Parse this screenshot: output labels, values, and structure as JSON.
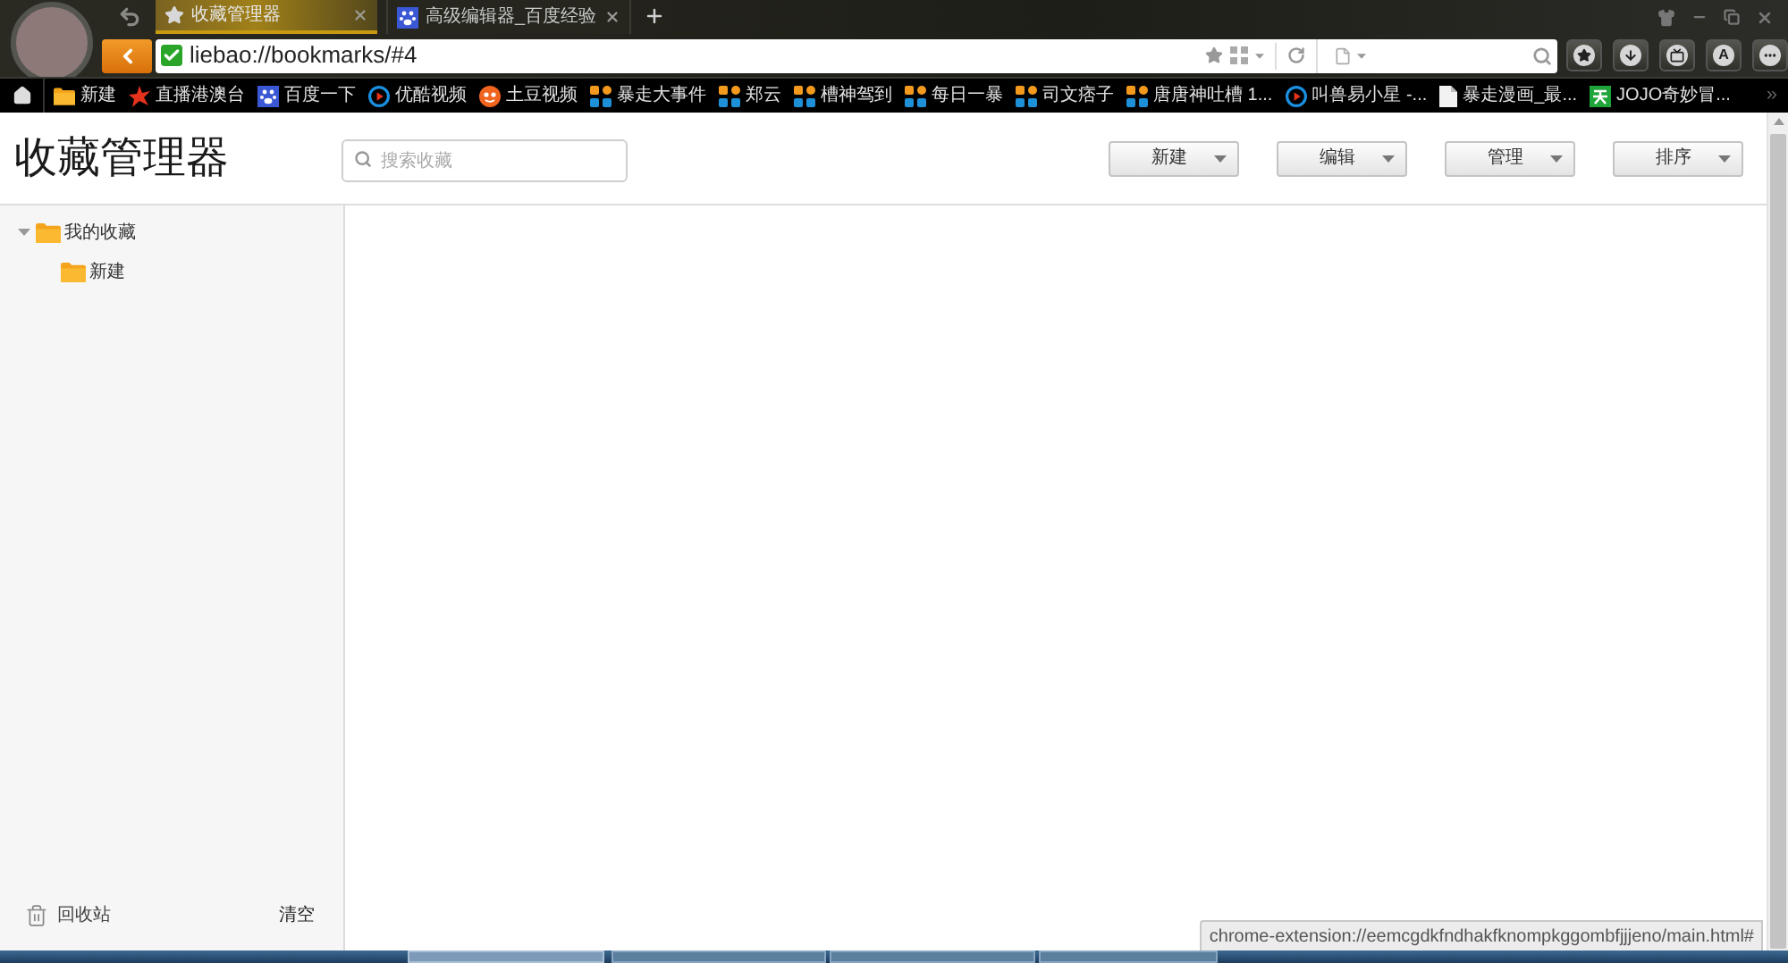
{
  "browser": {
    "tabs": [
      {
        "title": "收藏管理器",
        "kind": "star",
        "selected": true
      },
      {
        "title": "高级编辑器_百度经验",
        "kind": "paw",
        "selected": false
      }
    ],
    "address": "liebao://bookmarks/#4",
    "toolbar": [
      {
        "kind": "star"
      },
      {
        "kind": "download"
      },
      {
        "kind": "tv"
      },
      {
        "kind": "letter",
        "label": "A"
      },
      {
        "kind": "more"
      }
    ]
  },
  "bookmarks_bar": {
    "items": [
      {
        "label": "新建",
        "kind": "folder"
      },
      {
        "label": "直播港澳台",
        "kind": "burst"
      },
      {
        "label": "百度一下",
        "kind": "paw"
      },
      {
        "label": "优酷视频",
        "kind": "play"
      },
      {
        "label": "土豆视频",
        "kind": "face"
      },
      {
        "label": "暴走大事件",
        "kind": "blocks"
      },
      {
        "label": "郑云",
        "kind": "blocks"
      },
      {
        "label": "槽神驾到",
        "kind": "blocks"
      },
      {
        "label": "每日一暴",
        "kind": "blocks"
      },
      {
        "label": "司文痞子",
        "kind": "blocks"
      },
      {
        "label": "唐唐神吐槽 1...",
        "kind": "blocks"
      },
      {
        "label": "叫兽易小星 -...",
        "kind": "play"
      },
      {
        "label": "暴走漫画_最...",
        "kind": "page"
      },
      {
        "label": "JOJO奇妙冒...",
        "kind": "tile"
      }
    ],
    "overflow": "»"
  },
  "page": {
    "title": "收藏管理器",
    "search": {
      "placeholder": "搜索收藏"
    },
    "buttons": [
      "新建",
      "编辑",
      "管理",
      "排序"
    ]
  },
  "sidebar": {
    "tree": [
      {
        "label": "我的收藏",
        "expanded": true,
        "children": [
          {
            "label": "新建"
          }
        ]
      }
    ],
    "trash": {
      "label": "回收站",
      "action": "清空"
    }
  },
  "status_bar": "chrome-extension://eemcgdkfndhakfknompkggombfjjjeno/main.html#"
}
